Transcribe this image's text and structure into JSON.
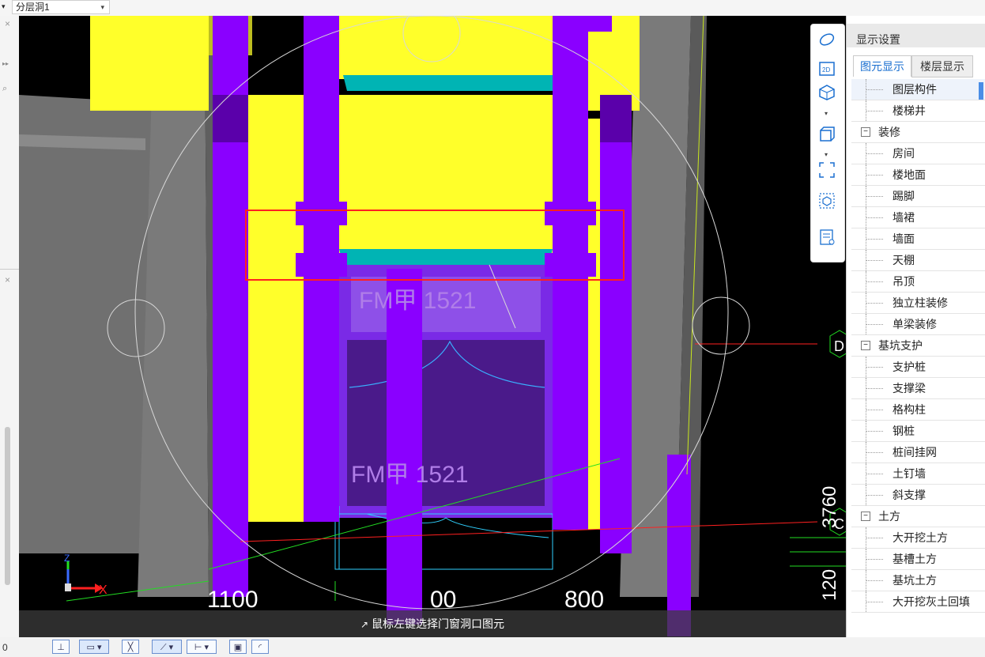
{
  "top": {
    "layer_select": "分层洞1"
  },
  "left": {
    "expand_glyph": "▸▸",
    "search_glyph": "⌕",
    "close_glyph": "×",
    "coord_text": "0"
  },
  "viewport": {
    "labels": {
      "fm1": "FM甲 1521",
      "fm2": "FM甲 1521",
      "dim_1100": "1100",
      "dim_00": "00",
      "dim_800": "800",
      "dim_3760": "3760",
      "dim_120": "120",
      "axis_d": "D",
      "axis_c": "C",
      "axis_x": "X",
      "axis_z": "Z"
    },
    "status_message": "鼠标左键选择门窗洞口图元",
    "colors": {
      "yellow": "#ffff2a",
      "purple": "#8a00ff",
      "teal": "#00b4b4",
      "red_box": "#ff2020",
      "gray": "#808080"
    }
  },
  "view_tools": [
    "orbit-icon",
    "2d-icon",
    "3d-view-icon",
    "cube-icon",
    "fit-view-icon",
    "view-box-icon",
    "layer-display-icon"
  ],
  "right_panel": {
    "title": "显示设置",
    "tabs": [
      "图元显示",
      "楼层显示"
    ],
    "tree": [
      {
        "label": "图层构件",
        "kind": "top",
        "selected": true
      },
      {
        "label": "楼梯井",
        "kind": "child"
      },
      {
        "label": "装修",
        "kind": "grp"
      },
      {
        "label": "房间",
        "kind": "child"
      },
      {
        "label": "楼地面",
        "kind": "child"
      },
      {
        "label": "踢脚",
        "kind": "child"
      },
      {
        "label": "墙裙",
        "kind": "child"
      },
      {
        "label": "墙面",
        "kind": "child"
      },
      {
        "label": "天棚",
        "kind": "child"
      },
      {
        "label": "吊顶",
        "kind": "child"
      },
      {
        "label": "独立柱装修",
        "kind": "child"
      },
      {
        "label": "单梁装修",
        "kind": "child"
      },
      {
        "label": "基坑支护",
        "kind": "grp"
      },
      {
        "label": "支护桩",
        "kind": "child"
      },
      {
        "label": "支撑梁",
        "kind": "child"
      },
      {
        "label": "格构柱",
        "kind": "child"
      },
      {
        "label": "钢桩",
        "kind": "child"
      },
      {
        "label": "桩间挂网",
        "kind": "child"
      },
      {
        "label": "土钉墙",
        "kind": "child"
      },
      {
        "label": "斜支撑",
        "kind": "child"
      },
      {
        "label": "土方",
        "kind": "grp"
      },
      {
        "label": "大开挖土方",
        "kind": "child"
      },
      {
        "label": "基槽土方",
        "kind": "child"
      },
      {
        "label": "基坑土方",
        "kind": "child"
      },
      {
        "label": "大开挖灰土回填",
        "kind": "child"
      }
    ]
  },
  "bottom_tools": [
    "ortho-icon",
    "select-rect-icon",
    "cross-select-icon",
    "line-draw-icon",
    "offset-icon",
    "snap-icon",
    "arc-icon"
  ]
}
